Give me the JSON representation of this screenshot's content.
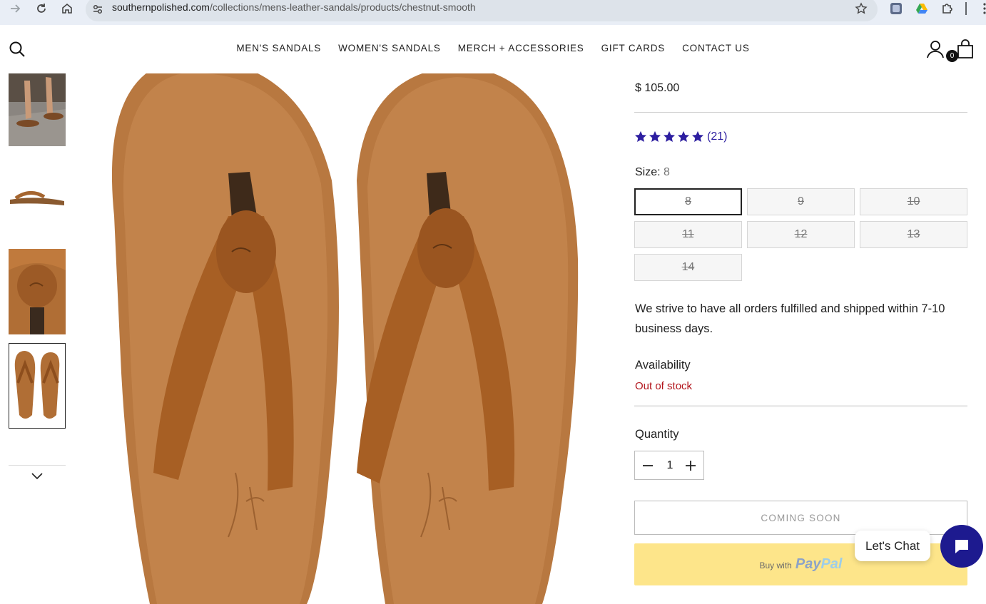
{
  "browser": {
    "url_host": "southernpolished.com",
    "url_path": "/collections/mens-leather-sandals/products/chestnut-smooth"
  },
  "header": {
    "nav": [
      "MEN'S SANDALS",
      "WOMEN'S SANDALS",
      "MERCH + ACCESSORIES",
      "GIFT CARDS",
      "CONTACT US"
    ],
    "cart_count": "0"
  },
  "product": {
    "price": "$ 105.00",
    "rating": 5,
    "review_count": "(21)",
    "size_label": "Size:",
    "size_selected": "8",
    "sizes": [
      "8",
      "9",
      "10",
      "11",
      "12",
      "13",
      "14"
    ],
    "shipping_note": "We strive to have all orders fulfilled and shipped within 7-10 business days.",
    "availability_label": "Availability",
    "availability_value": "Out of stock",
    "quantity_label": "Quantity",
    "quantity_value": "1",
    "coming_soon_label": "COMING SOON",
    "paypal_buy_text": "Buy with",
    "paypal_logo_pay": "Pay",
    "paypal_logo_pal": "Pal"
  },
  "chat": {
    "label": "Let's Chat"
  },
  "colors": {
    "star": "#2d1ea0",
    "out_of_stock": "#b2141b",
    "paypal_bg": "#fde58a",
    "chat_button": "#1d1a8f"
  }
}
